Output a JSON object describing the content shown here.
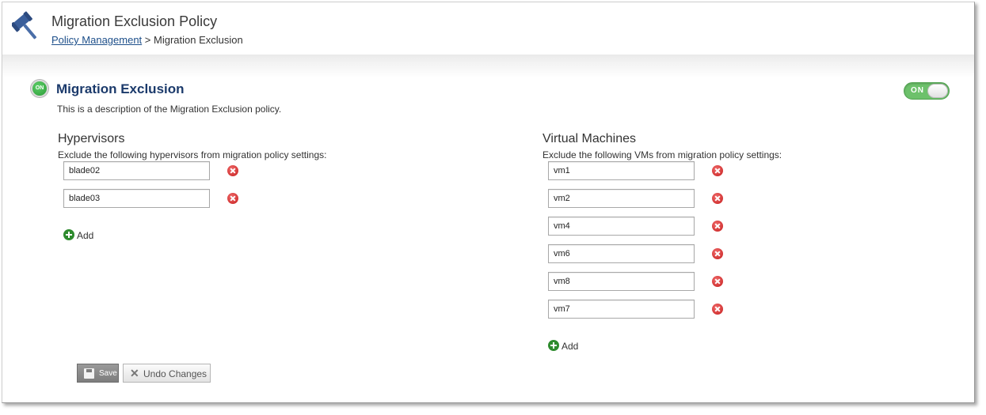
{
  "header": {
    "title": "Migration Exclusion Policy",
    "breadcrumb_link": "Policy Management",
    "breadcrumb_separator": ">",
    "breadcrumb_current": "Migration Exclusion",
    "icon": "gavel-icon"
  },
  "section": {
    "status_badge": "ON",
    "title": "Migration Exclusion",
    "description": "This is a description of the Migration Exclusion policy.",
    "toggle_label": "ON",
    "toggle_state": "on"
  },
  "hypervisors": {
    "title": "Hypervisors",
    "subtitle": "Exclude the following hypervisors from migration policy settings:",
    "items": [
      "blade02",
      "blade03"
    ],
    "add_label": "Add"
  },
  "vms": {
    "title": "Virtual Machines",
    "subtitle": "Exclude the following VMs from migration policy settings:",
    "items": [
      "vm1",
      "vm2",
      "vm4",
      "vm6",
      "vm8",
      "vm7"
    ],
    "add_label": "Add"
  },
  "actions": {
    "save_label": "Save",
    "undo_label": "Undo Changes"
  },
  "colors": {
    "title_blue": "#1b3a6b",
    "toggle_green": "#6dc16b",
    "remove_red": "#c61e1e",
    "add_green": "#2e8b2e"
  }
}
